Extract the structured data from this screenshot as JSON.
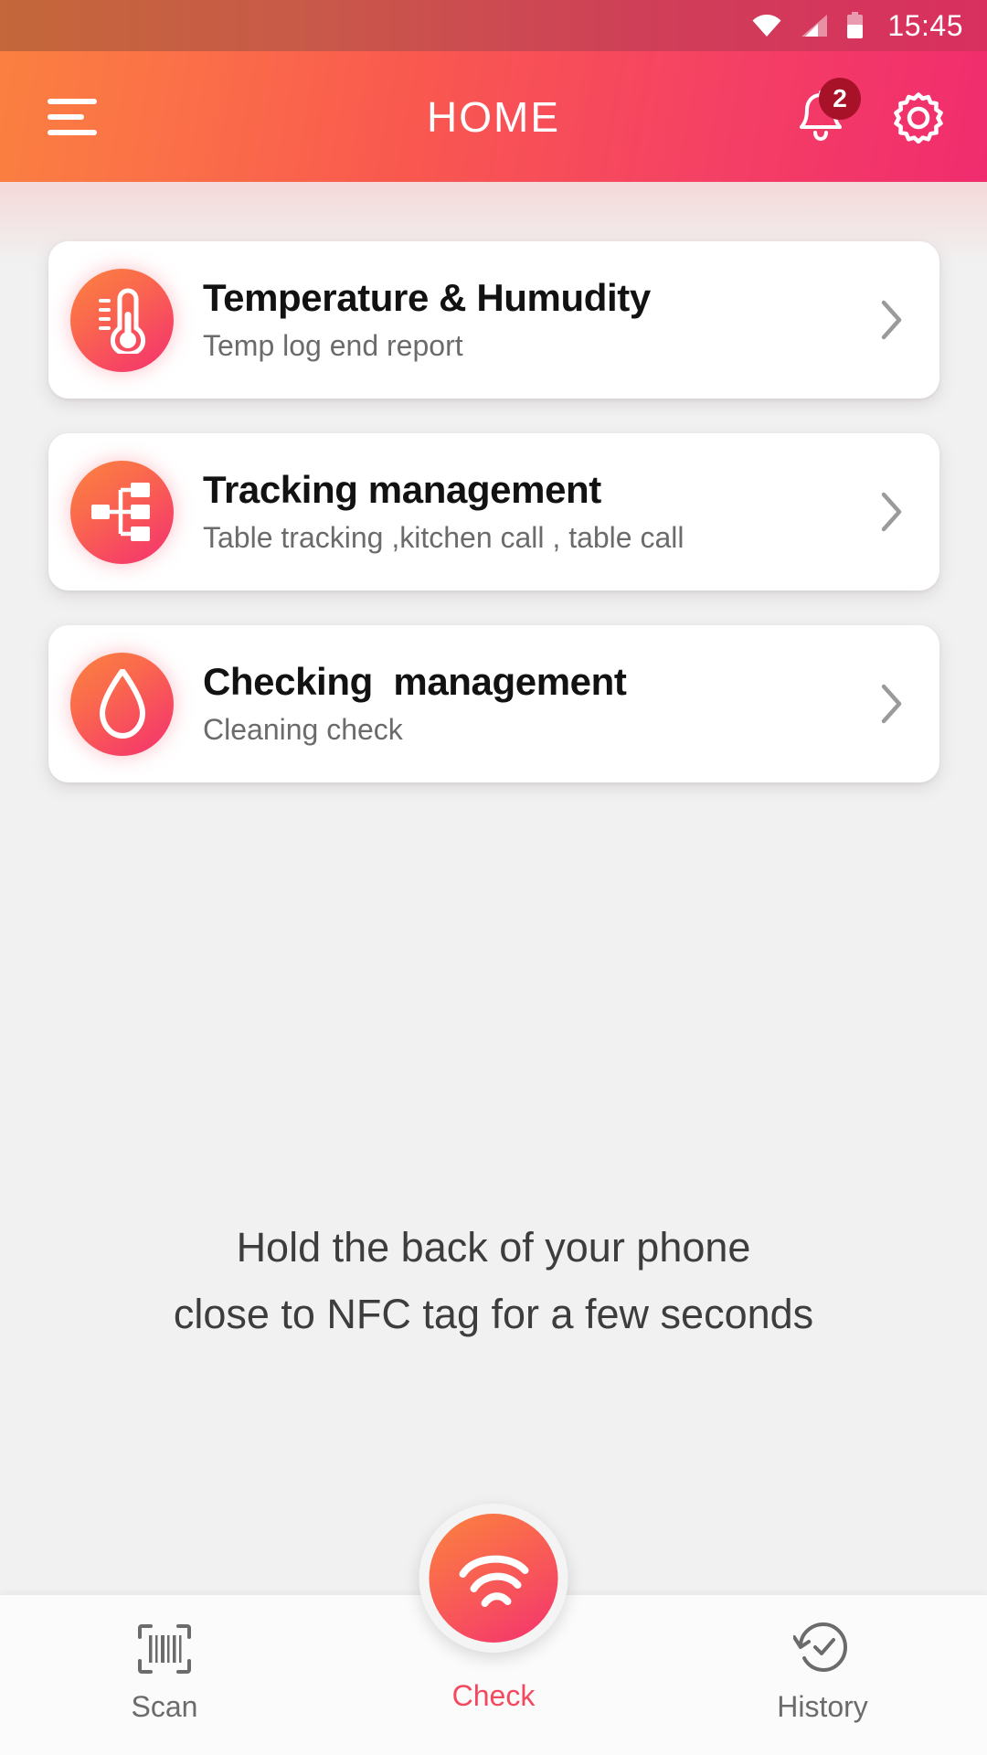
{
  "status_bar": {
    "time": "15:45",
    "icons": [
      "wifi-icon",
      "cellular-signal-icon",
      "battery-icon"
    ]
  },
  "app_bar": {
    "title": "HOME",
    "menu_icon": "hamburger-menu-icon",
    "notification_icon": "bell-icon",
    "notification_badge": "2",
    "settings_icon": "gear-icon",
    "gradient_start": "#fb8040",
    "gradient_end": "#f02c6e"
  },
  "cards": [
    {
      "icon": "thermometer-icon",
      "title": "Temperature & Humudity",
      "subtitle": "Temp log end report",
      "chevron": "chevron-right-icon"
    },
    {
      "icon": "sitemap-icon",
      "title": "Tracking management",
      "subtitle": "Table tracking ,kitchen call , table call",
      "chevron": "chevron-right-icon"
    },
    {
      "icon": "water-drop-icon",
      "title": "Checking  management",
      "subtitle": "Cleaning check",
      "chevron": "chevron-right-icon"
    }
  ],
  "nfc_hint": {
    "line1": "Hold the back of your phone",
    "line2": "close to NFC tag for a few seconds"
  },
  "bottom_nav": {
    "items": [
      {
        "label": "Scan",
        "icon": "barcode-scan-icon",
        "active": false
      },
      {
        "label": "Check",
        "icon": "nfc-wave-icon",
        "active": true
      },
      {
        "label": "History",
        "icon": "clock-rotate-check-icon",
        "active": false
      }
    ],
    "fab_icon": "nfc-wave-icon",
    "active_color": "#f4485f",
    "inactive_color": "#6b6b6b"
  }
}
